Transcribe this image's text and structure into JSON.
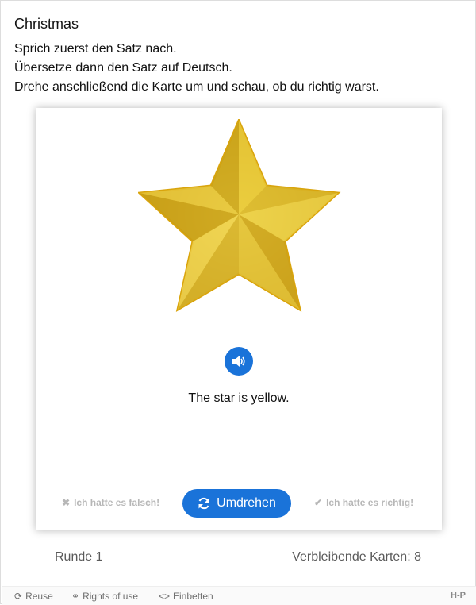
{
  "title": "Christmas",
  "instructions": [
    "Sprich zuerst den Satz nach.",
    "Übersetze dann den Satz auf Deutsch.",
    "Drehe anschließend die Karte um und schau, ob du richtig warst."
  ],
  "card": {
    "image_icon": "star-icon",
    "audio_icon": "speaker-icon",
    "text": "The star is yellow."
  },
  "actions": {
    "wrong_label": "Ich hatte es falsch!",
    "flip_label": "Umdrehen",
    "right_label": "Ich hatte es richtig!"
  },
  "status": {
    "round": "Runde 1",
    "remaining": "Verbleibende Karten: 8"
  },
  "footer": {
    "reuse": "Reuse",
    "rights": "Rights of use",
    "embed": "Einbetten",
    "brand": "H-P"
  },
  "colors": {
    "accent": "#1a73d9",
    "disabled_text": "#b7b7b7",
    "star": "#d4b21f"
  }
}
